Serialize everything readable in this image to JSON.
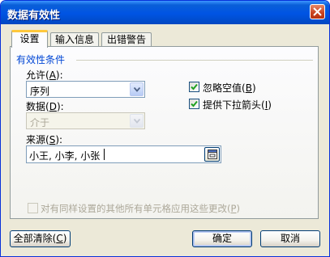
{
  "window": {
    "title": "数据有效性",
    "close_icon": "close-icon"
  },
  "tabs": [
    {
      "label": "设置",
      "active": true
    },
    {
      "label": "输入信息",
      "active": false
    },
    {
      "label": "出错警告",
      "active": false
    }
  ],
  "settings": {
    "group_title": "有效性条件",
    "allow": {
      "label": "允许",
      "mnemonic": "A",
      "value": "序列"
    },
    "data": {
      "label": "数据",
      "mnemonic": "D",
      "value": "介于",
      "enabled": false
    },
    "ignore_blank": {
      "label": "忽略空值",
      "mnemonic": "B",
      "checked": true
    },
    "in_cell_dropdown": {
      "label": "提供下拉箭头",
      "mnemonic": "I",
      "checked": true
    },
    "source": {
      "label": "来源",
      "mnemonic": "S",
      "value": "小王, 小李, 小张"
    },
    "apply_all": {
      "label": "对有同样设置的其他所有单元格应用这些更改",
      "mnemonic": "P",
      "checked": false,
      "enabled": false
    }
  },
  "buttons": {
    "clear_all": {
      "label": "全部清除",
      "mnemonic": "C"
    },
    "ok": "确定",
    "cancel": "取消"
  },
  "colors": {
    "title_bar": "#0054e3",
    "group_title": "#0046d5",
    "dialog_bg": "#ece9d8",
    "tab_highlight": "#ffc83c"
  }
}
